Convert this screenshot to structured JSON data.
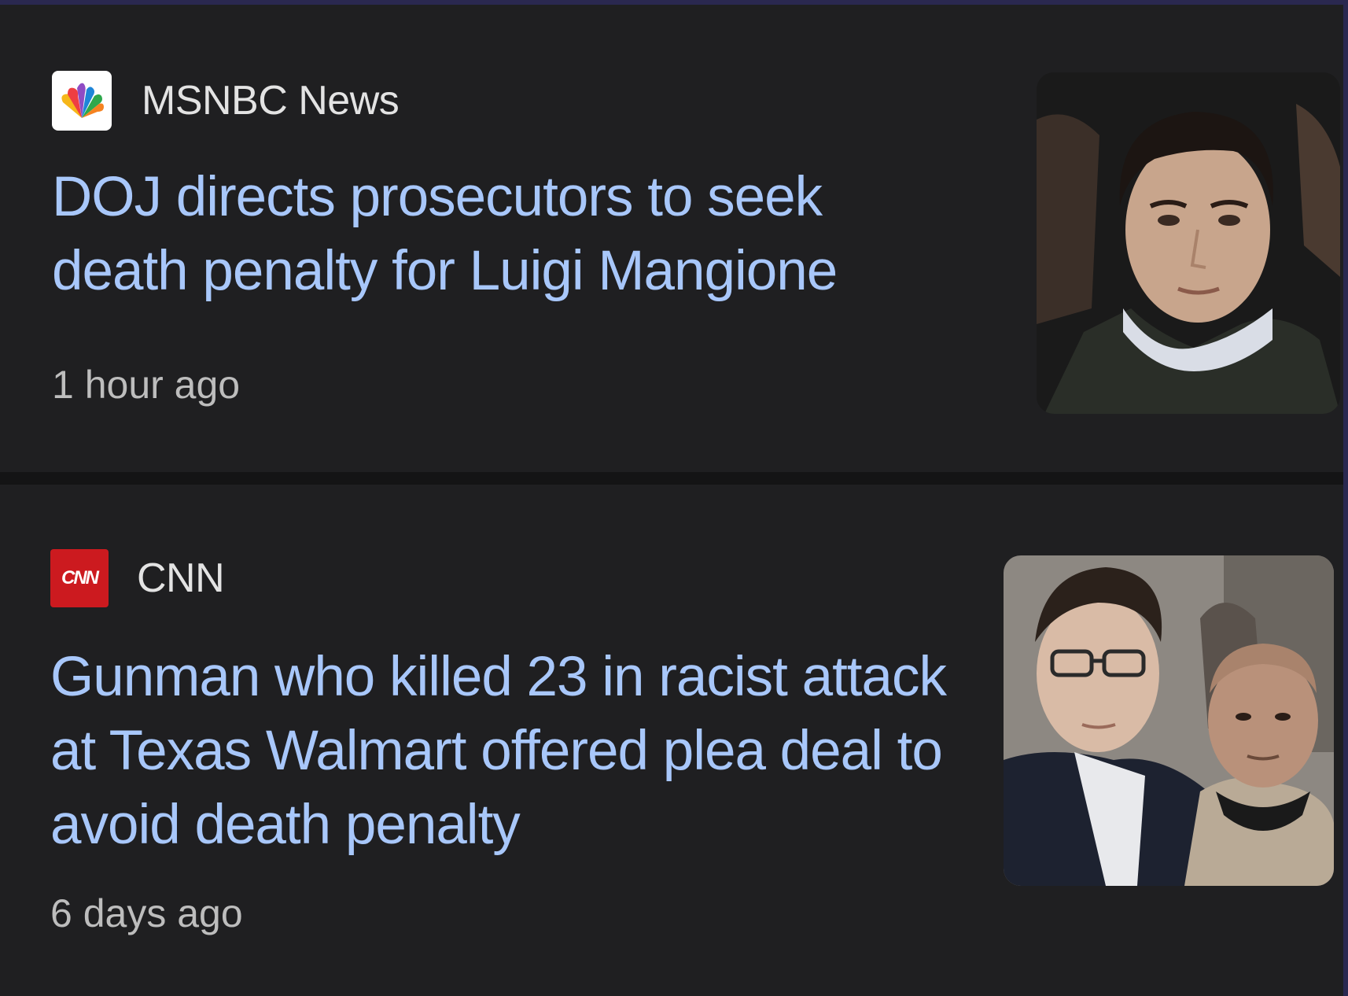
{
  "articles": [
    {
      "source": {
        "name": "MSNBC News",
        "logo_icon": "peacock-logo-icon"
      },
      "headline": "DOJ directs prosecutors to seek death penalty for Luigi Mangione",
      "time": "1 hour ago",
      "thumbnail": "portrait-photo"
    },
    {
      "source": {
        "name": "CNN",
        "logo_text": "CNN",
        "logo_icon": "cnn-logo-icon"
      },
      "headline": "Gunman who killed 23 in racist attack at Texas Walmart offered plea deal to avoid death penalty",
      "time": "6 days ago",
      "thumbnail": "courtroom-photo"
    }
  ],
  "colors": {
    "background": "#1f1f21",
    "headline": "#a8c7fa",
    "source_text": "#e3e3e3",
    "time_text": "#bdbdbd",
    "cnn_red": "#cc1a1f"
  }
}
